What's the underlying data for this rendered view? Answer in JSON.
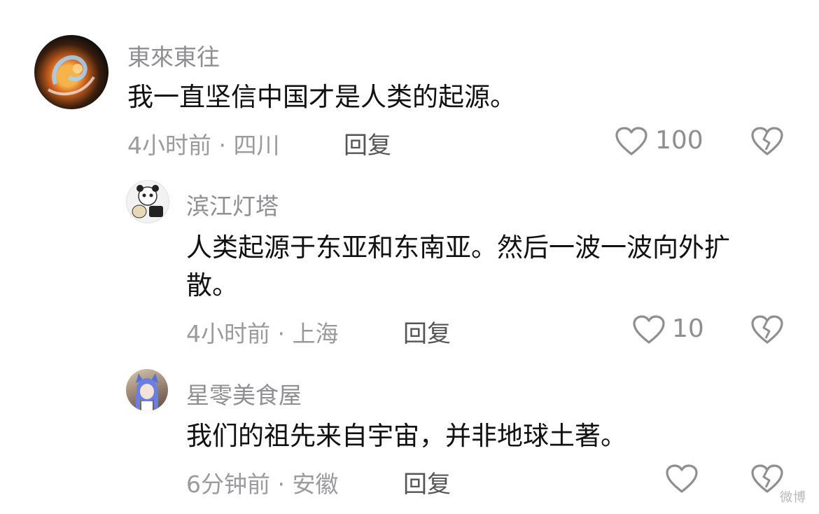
{
  "comments": [
    {
      "username": "東來東往",
      "text": "我一直坚信中国才是人类的起源。",
      "meta": "4小时前 · 四川",
      "reply_label": "回复",
      "like_count": "100"
    },
    {
      "username": "滨江灯塔",
      "text": "人类起源于东亚和东南亚。然后一波一波向外扩散。",
      "meta": "4小时前 · 上海",
      "reply_label": "回复",
      "like_count": "10"
    },
    {
      "username": "星零美食屋",
      "text": "我们的祖先来自宇宙，并非地球土著。",
      "meta": "6分钟前 · 安徽",
      "reply_label": "回复",
      "like_count": ""
    }
  ],
  "icons": {
    "like": "heart-outline-icon",
    "dislike": "broken-heart-icon"
  },
  "watermark": "微博"
}
